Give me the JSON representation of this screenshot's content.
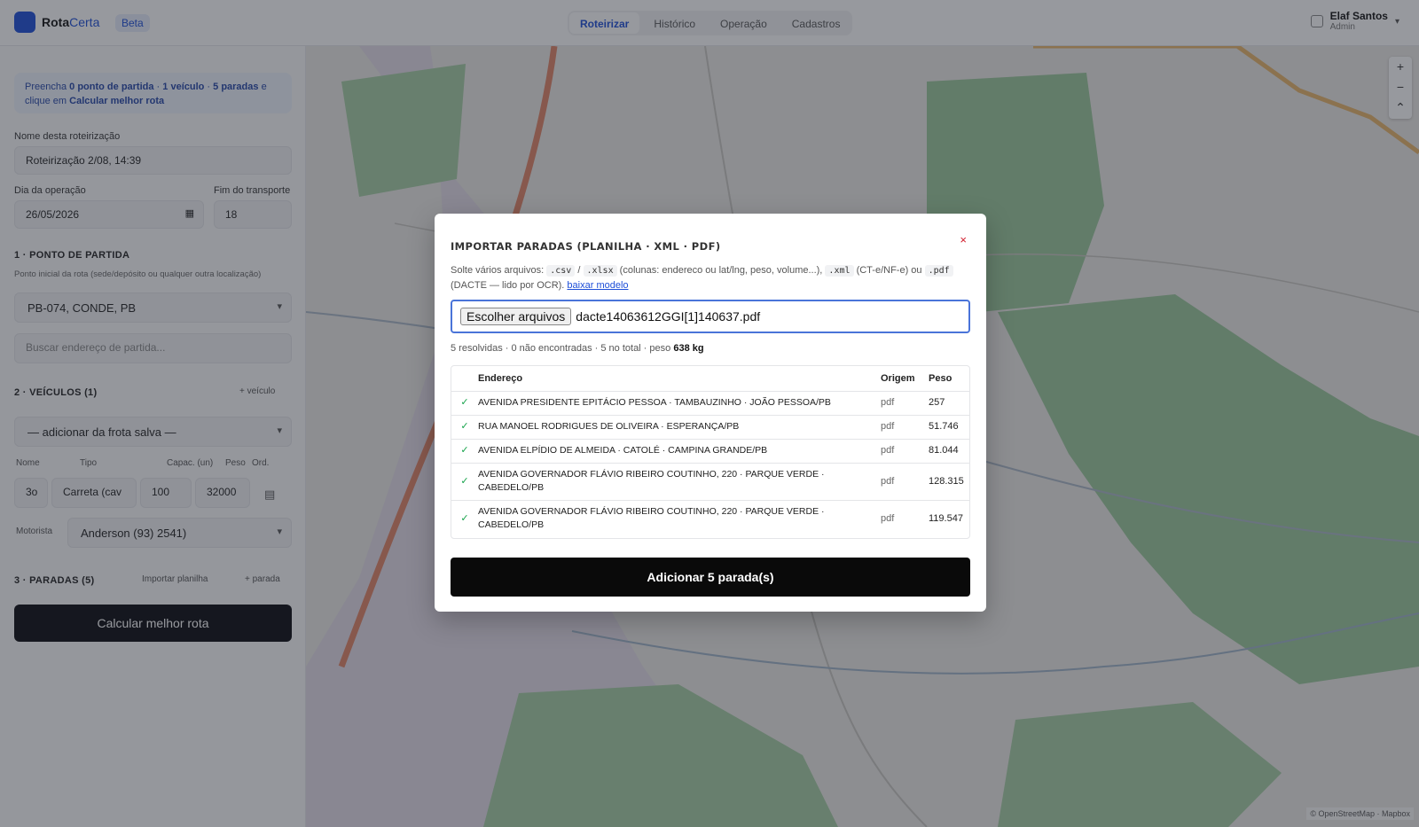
{
  "app": {
    "logo_text": "Rota",
    "logo_accent": "Certa",
    "badge": "Beta"
  },
  "nav": {
    "items": [
      "Roteirizar",
      "Histórico",
      "Operação",
      "Cadastros"
    ],
    "active": 0
  },
  "user": {
    "name": "Elaf Santos",
    "role": "Admin"
  },
  "sidebar": {
    "info": {
      "text_pre": "Preencha",
      "points": "0 ponto de partida",
      "vehicles": "1 veículo",
      "stops": "5 paradas",
      "suffix": "e clique em",
      "action": "Calcular melhor rota"
    },
    "route_name_label": "Nome desta roteirização",
    "route_name_value": "Roteirização 2/08, 14:39",
    "date_label": "Dia da operação",
    "date_value": "26/05/2026",
    "endtime_label": "Fim do transporte",
    "endtime_value": "18",
    "section_start": "1 · PONTO DE PARTIDA",
    "start_hint": "Ponto inicial da rota (sede/depósito ou qualquer outra localização)",
    "start_select": "PB-074, CONDE, PB",
    "start_search_placeholder": "Buscar endereço de partida...",
    "section_vehicles": "2 · VEÍCULOS (1)",
    "vehicles_action": "+ veículo",
    "fleet_select": "— adicionar da frota salva —",
    "vehicle_headers": [
      "Nome",
      "Tipo",
      "Capac. (un)",
      "Peso",
      "Ord."
    ],
    "vehicle_row": {
      "name": "3o",
      "type": "Carreta (cav",
      "cap": "100",
      "weight": "32000"
    },
    "driver_label": "Motorista",
    "driver_value": "Anderson (93) 2541)",
    "section_stops": "3 · PARADAS (5)",
    "stops_import": "Importar planilha",
    "stops_add": "+ parada",
    "calc_button": "Calcular melhor rota"
  },
  "map": {
    "attribution": "© OpenStreetMap · Mapbox"
  },
  "modal": {
    "title": "IMPORTAR PARADAS (PLANILHA · XML · PDF)",
    "close": "×",
    "desc_pre": "Solte vários arquivos:",
    "code_csv": ".csv",
    "code_xlsx": ".xlsx",
    "desc_mid": "(colunas: endereco ou lat/lng, peso, volume...),",
    "code_xml": ".xml",
    "desc_mid2": "(CT-e/NF-e) ou",
    "code_pdf": ".pdf",
    "desc_post": "(DACTE — lido por OCR).",
    "download_link": "baixar modelo",
    "file_button": "Escolher arquivos",
    "file_name": "dacte14063612GGI[1]140637.pdf",
    "summary_text": "5 resolvidas · 0 não encontradas · 5 no total · peso",
    "summary_weight": "638 kg",
    "table": {
      "headers": [
        "Endereço",
        "Origem",
        "Peso"
      ],
      "rows": [
        {
          "address": "AVENIDA PRESIDENTE EPITÁCIO PESSOA · TAMBAUZINHO · JOÃO PESSOA/PB",
          "origin": "pdf",
          "weight": "257"
        },
        {
          "address": "RUA MANOEL RODRIGUES DE OLIVEIRA · ESPERANÇA/PB",
          "origin": "pdf",
          "weight": "51.746"
        },
        {
          "address": "AVENIDA ELPÍDIO DE ALMEIDA · CATOLÉ · CAMPINA GRANDE/PB",
          "origin": "pdf",
          "weight": "81.044"
        },
        {
          "address": "AVENIDA GOVERNADOR FLÁVIO RIBEIRO COUTINHO, 220 · PARQUE VERDE · CABEDELO/PB",
          "origin": "pdf",
          "weight": "128.315"
        },
        {
          "address": "AVENIDA GOVERNADOR FLÁVIO RIBEIRO COUTINHO, 220 · PARQUE VERDE · CABEDELO/PB",
          "origin": "pdf",
          "weight": "119.547"
        }
      ]
    },
    "add_button": "Adicionar 5 parada(s)"
  }
}
